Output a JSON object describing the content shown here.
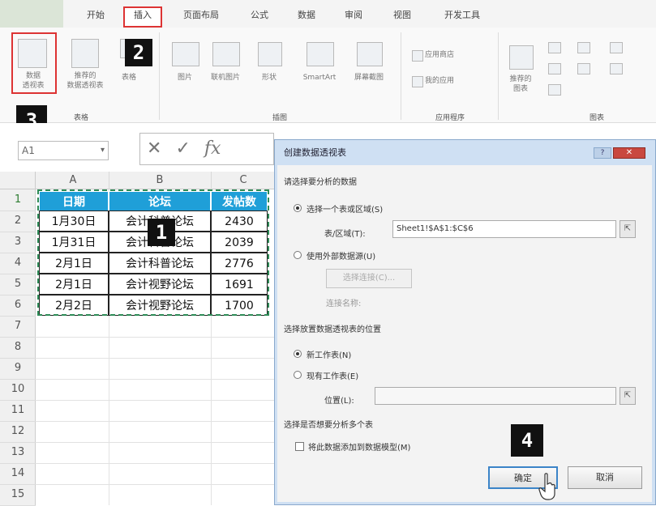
{
  "ribbon": {
    "tabs": [
      "开始",
      "插入",
      "页面布局",
      "公式",
      "数据",
      "审阅",
      "视图",
      "开发工具"
    ],
    "buttons": {
      "pivot_table": "数据\n透视表",
      "recommended_pivot": "推荐的\n数据透视表",
      "table": "表格",
      "pictures": "图片",
      "online_pictures": "联机图片",
      "shapes": "形状",
      "smartart": "SmartArt",
      "screenshot": "屏幕截图",
      "app_store": "应用商店",
      "my_apps": "我的应用",
      "recommended_charts": "推荐的\n图表"
    },
    "groups": {
      "tables": "表格",
      "illustrations": "插图",
      "apps": "应用程序",
      "charts": "图表"
    }
  },
  "step_badges": [
    "1",
    "2",
    "3",
    "4"
  ],
  "formula_bar": {
    "name_box": "A1",
    "fx": "fx",
    "cancel": "✕",
    "enter": "✓"
  },
  "sheet": {
    "columns": [
      "A",
      "B",
      "C"
    ],
    "rows": [
      "1",
      "2",
      "3",
      "4",
      "5",
      "6",
      "7",
      "8",
      "9",
      "10",
      "11",
      "12",
      "13",
      "14",
      "15"
    ],
    "headers": [
      "日期",
      "论坛",
      "发帖数"
    ],
    "data": [
      [
        "1月30日",
        "会计科普论坛",
        "2430"
      ],
      [
        "1月31日",
        "会计科普论坛",
        "2039"
      ],
      [
        "2月1日",
        "会计科普论坛",
        "2776"
      ],
      [
        "2月1日",
        "会计视野论坛",
        "1691"
      ],
      [
        "2月2日",
        "会计视野论坛",
        "1700"
      ]
    ]
  },
  "dialog": {
    "title": "创建数据透视表",
    "help": "?",
    "close": "✕",
    "section_data": "请选择要分析的数据",
    "opt_select_range": "选择一个表或区域(S)",
    "range_label": "表/区域(T):",
    "range_value": "Sheet1!$A$1:$C$6",
    "opt_external": "使用外部数据源(U)",
    "choose_connection": "选择连接(C)...",
    "connection_name": "连接名称:",
    "section_location": "选择放置数据透视表的位置",
    "opt_new_sheet": "新工作表(N)",
    "opt_existing_sheet": "现有工作表(E)",
    "location_label": "位置(L):",
    "location_value": "",
    "section_multi": "选择是否想要分析多个表",
    "add_to_model": "将此数据添加到数据模型(M)",
    "ok": "确定",
    "cancel": "取消"
  },
  "colors": {
    "header_blue": "#1f9fd8",
    "highlight_red": "#d33",
    "marquee_green": "#2e8b57"
  }
}
